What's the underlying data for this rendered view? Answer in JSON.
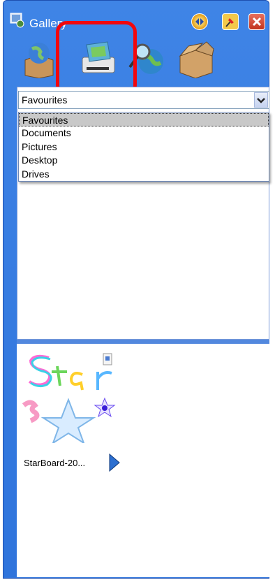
{
  "window": {
    "title": "Gallery"
  },
  "toolbar": {
    "tools": [
      {
        "icon": "globe-box-icon"
      },
      {
        "icon": "scanner-photos-icon"
      },
      {
        "icon": "search-globe-icon"
      },
      {
        "icon": "open-box-icon"
      }
    ]
  },
  "location_select": {
    "value": "Favourites",
    "options": [
      "Favourites",
      "Documents",
      "Pictures",
      "Desktop",
      "Drives"
    ]
  },
  "files": [
    {
      "label": "StarBoard-20..."
    }
  ],
  "colors": {
    "frame": "#3f84e6",
    "highlight": "#f2070d",
    "divider": "#5288de"
  }
}
